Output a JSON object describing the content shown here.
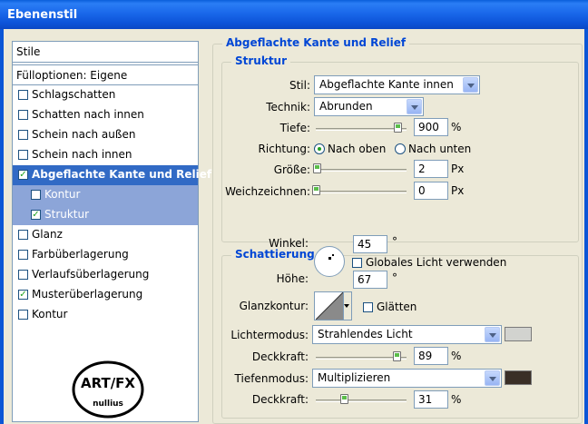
{
  "window": {
    "title": "Ebenenstil"
  },
  "styles_panel": {
    "header": "Stile",
    "fill_options": "Fülloptionen: Eigene",
    "items": [
      {
        "label": "Schlagschatten",
        "checked": false
      },
      {
        "label": "Schatten nach innen",
        "checked": false
      },
      {
        "label": "Schein nach außen",
        "checked": false
      },
      {
        "label": "Schein nach innen",
        "checked": false
      },
      {
        "label": "Abgeflachte Kante und Relief",
        "checked": true,
        "selected": true
      },
      {
        "label": "Kontur",
        "checked": false,
        "sub": true
      },
      {
        "label": "Struktur",
        "checked": true,
        "sub": true
      },
      {
        "label": "Glanz",
        "checked": false
      },
      {
        "label": "Farbüberlagerung",
        "checked": false
      },
      {
        "label": "Verlaufsüberlagerung",
        "checked": false
      },
      {
        "label": "Musterüberlagerung",
        "checked": true
      },
      {
        "label": "Kontur",
        "checked": false
      }
    ],
    "check_mark": "✓",
    "logo_text": "ART/FX",
    "logo_sub": "nullius"
  },
  "bevel": {
    "section_title": "Abgeflachte Kante und Relief",
    "structure": {
      "title": "Struktur",
      "style_label": "Stil:",
      "style_value": "Abgeflachte Kante innen",
      "technique_label": "Technik:",
      "technique_value": "Abrunden",
      "depth_label": "Tiefe:",
      "depth_value": "900",
      "depth_unit": "%",
      "depth_level": 0.9,
      "direction_label": "Richtung:",
      "direction_up": "Nach oben",
      "direction_down": "Nach unten",
      "size_label": "Größe:",
      "size_value": "2",
      "size_unit": "Px",
      "size_level": 0.01,
      "soften_label": "Weichzeichnen:",
      "soften_value": "0",
      "soften_unit": "Px",
      "soften_level": 0.0
    },
    "shading": {
      "title": "Schattierung",
      "angle_label": "Winkel:",
      "angle_value": "45",
      "angle_unit": "°",
      "global_light_label": "Globales Licht verwenden",
      "altitude_label": "Höhe:",
      "altitude_value": "67",
      "altitude_unit": "°",
      "gloss_label": "Glanzkontur:",
      "antialias_label": "Glätten",
      "highlight_mode_label": "Lichtermodus:",
      "highlight_mode_value": "Strahlendes Licht",
      "highlight_color": "#d2d3cf",
      "highlight_opacity_label": "Deckkraft:",
      "highlight_opacity_value": "89",
      "highlight_opacity_unit": "%",
      "highlight_opacity_level": 0.89,
      "shadow_mode_label": "Tiefenmodus:",
      "shadow_mode_value": "Multiplizieren",
      "shadow_color": "#3a2f26",
      "shadow_opacity_label": "Deckkraft:",
      "shadow_opacity_value": "31",
      "shadow_opacity_unit": "%",
      "shadow_opacity_level": 0.31
    }
  },
  "colors": {
    "accent": "#316ac5",
    "legend": "#0046d5",
    "titlebar": "#0a5fdb"
  }
}
